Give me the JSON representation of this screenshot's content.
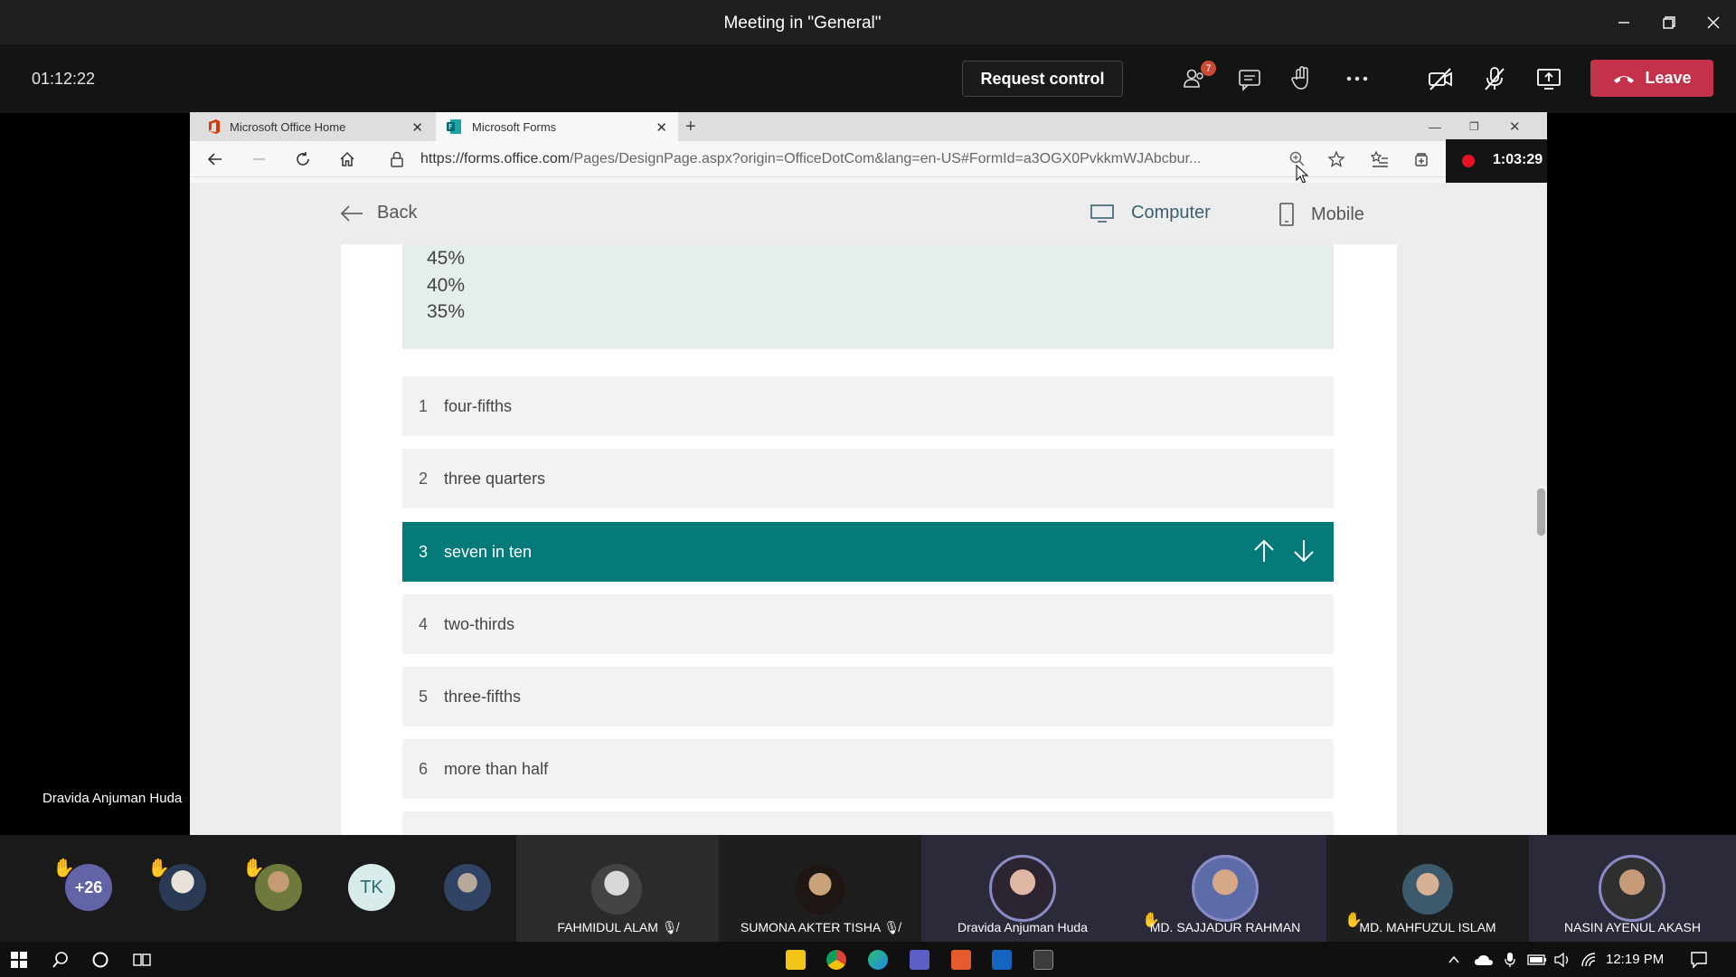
{
  "window": {
    "title": "Meeting in \"General\""
  },
  "toolbar": {
    "timer": "01:12:22",
    "request_control": "Request control",
    "participants_count": "7",
    "leave": "Leave"
  },
  "browser": {
    "tabs": [
      {
        "label": "Microsoft Office Home"
      },
      {
        "label": "Microsoft Forms"
      }
    ],
    "url_main": "https://forms.office.com",
    "url_rest": "/Pages/DesignPage.aspx?origin=OfficeDotCom&lang=en-US#FormId=a3OGX0PvkkmWJAbcbur...",
    "recording_time": "1:03:29"
  },
  "form": {
    "back": "Back",
    "view_computer": "Computer",
    "view_mobile": "Mobile",
    "percentages": [
      "45%",
      "40%",
      "35%"
    ],
    "options": [
      {
        "num": "1",
        "label": "four-fifths"
      },
      {
        "num": "2",
        "label": "three quarters"
      },
      {
        "num": "3",
        "label": "seven in ten"
      },
      {
        "num": "4",
        "label": "two-thirds"
      },
      {
        "num": "5",
        "label": "three-fifths"
      },
      {
        "num": "6",
        "label": "more than half"
      }
    ]
  },
  "presenter": "Dravida Anjuman Huda",
  "participants": {
    "overflow": "+26",
    "initials": "TK",
    "named": [
      {
        "name": "FAHMIDUL ALAM"
      },
      {
        "name": "SUMONA AKTER TISHA"
      },
      {
        "name": "Dravida Anjuman Huda"
      },
      {
        "name": "MD. SAJJADUR RAHMAN"
      },
      {
        "name": "MD. MAHFUZUL ISLAM"
      },
      {
        "name": "NASIN AYENUL AKASH"
      }
    ]
  },
  "taskbar": {
    "time": "12:19 PM"
  },
  "colors": {
    "leave": "#c4314b",
    "selected_option": "#047a7a",
    "accent_purple": "#6264a7"
  }
}
